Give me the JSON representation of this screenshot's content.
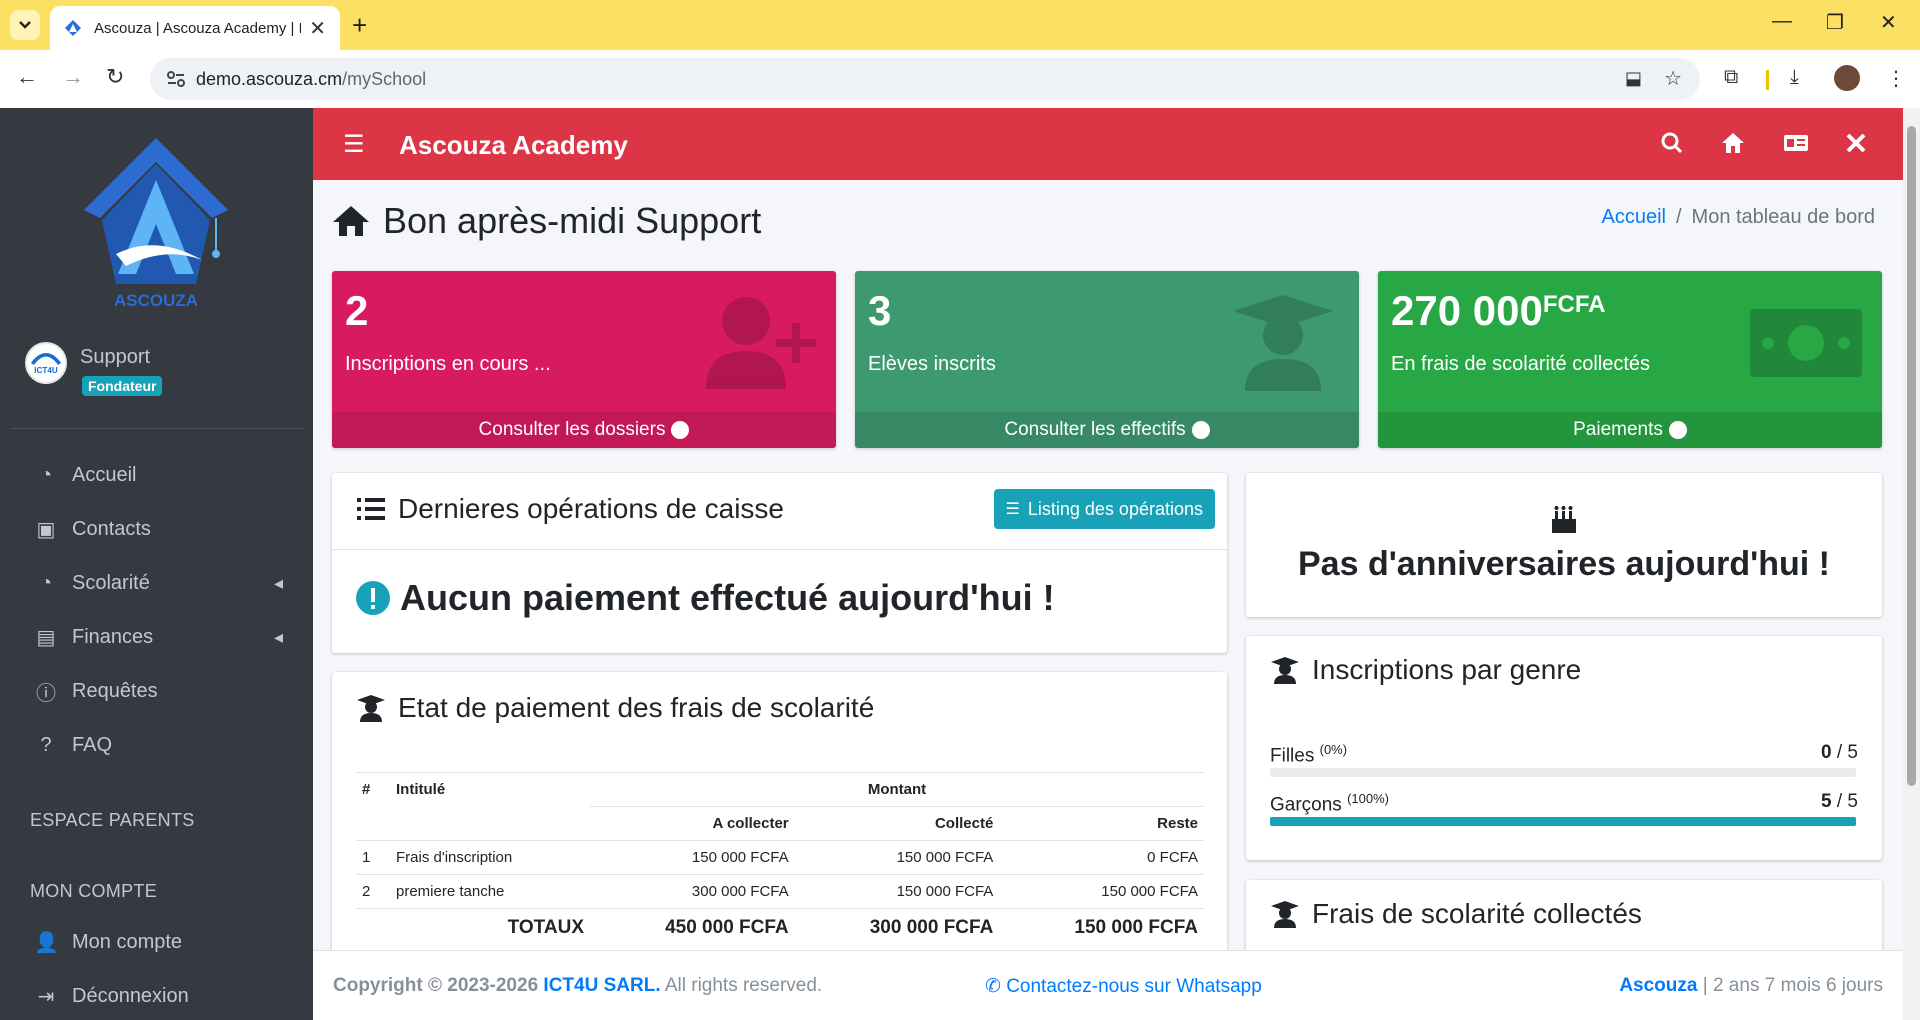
{
  "browser": {
    "tab_title": "Ascouza | Ascouza Academy | B",
    "url_host": "demo.ascouza.cm",
    "url_path": "/mySchool"
  },
  "sidebar": {
    "user_name": "Support",
    "user_role": "Fondateur",
    "logo_text": "ASCOUZA",
    "avatar_text": "ICT4U",
    "items": [
      {
        "label": "Accueil",
        "icon": "dashboard-icon"
      },
      {
        "label": "Contacts",
        "icon": "address-book-icon"
      },
      {
        "label": "Scolarité",
        "icon": "dashboard-icon"
      },
      {
        "label": "Finances",
        "icon": "cash-register-icon"
      },
      {
        "label": "Requêtes",
        "icon": "info-circle-icon"
      },
      {
        "label": "FAQ",
        "icon": "question-circle-icon"
      }
    ],
    "header_parents": "ESPACE PARENTS",
    "header_account": "MON COMPTE",
    "account_items": [
      {
        "label": "Mon compte",
        "icon": "user-icon"
      },
      {
        "label": "Déconnexion",
        "icon": "sign-out-icon"
      }
    ]
  },
  "header": {
    "brand": "Ascouza Academy"
  },
  "page": {
    "title": "Bon après-midi Support",
    "breadcrumb_home": "Accueil",
    "breadcrumb_current": "Mon tableau de bord"
  },
  "boxes": [
    {
      "value": "2",
      "unit": "",
      "label": "Inscriptions en cours ...",
      "link": "Consulter les dossiers",
      "color": "#d81b60",
      "icon": "user-plus-icon"
    },
    {
      "value": "3",
      "unit": "",
      "label": "Elèves inscrits",
      "link": "Consulter les effectifs",
      "color": "#3d9970",
      "icon": "user-graduate-icon"
    },
    {
      "value": "270 000",
      "unit": "FCFA",
      "label": "En frais de scolarité collectés",
      "link": "Paiements",
      "color": "#28a745",
      "icon": "money-bill-icon"
    }
  ],
  "ops": {
    "title": "Dernieres opérations de caisse",
    "button": "Listing des opérations",
    "message": "Aucun paiement effectué aujourd'hui !"
  },
  "birthdays": {
    "message": "Pas d'anniversaires aujourd'hui !"
  },
  "fees": {
    "title": "Etat de paiement des frais de scolarité",
    "col_num": "#",
    "col_label": "Intitulé",
    "col_amount": "Montant",
    "col_to_collect": "A collecter",
    "col_collected": "Collecté",
    "col_remaining": "Reste",
    "rows": [
      {
        "num": "1",
        "label": "Frais d'inscription",
        "to_collect": "150 000 FCFA",
        "collected": "150 000 FCFA",
        "remaining": "0 FCFA"
      },
      {
        "num": "2",
        "label": "premiere tanche",
        "to_collect": "300 000 FCFA",
        "collected": "150 000 FCFA",
        "remaining": "150 000 FCFA"
      }
    ],
    "totals_label": "TOTAUX",
    "totals": {
      "to_collect": "450 000 FCFA",
      "collected": "300 000 FCFA",
      "remaining": "150 000 FCFA"
    }
  },
  "gender": {
    "title": "Inscriptions par genre",
    "girls_label": "Filles",
    "girls_pct": "(0%)",
    "girls_count": "0",
    "girls_total": "/ 5",
    "girls_fraction": 0,
    "boys_label": "Garçons",
    "boys_pct": "(100%)",
    "boys_count": "5",
    "boys_total": "/ 5",
    "boys_fraction": 1
  },
  "collected_card": {
    "title": "Frais de scolarité collectés"
  },
  "footer": {
    "copyright": "Copyright © 2023-2026",
    "company": "ICT4U SARL.",
    "rights": "All rights reserved.",
    "whatsapp": "Contactez-nous sur Whatsapp",
    "app_name": "Ascouza",
    "age": "| 2 ans 7 mois 6 jours"
  },
  "colors": {
    "header": "#dc3545",
    "sidebar": "#343a40",
    "accent": "#17a2b8"
  }
}
